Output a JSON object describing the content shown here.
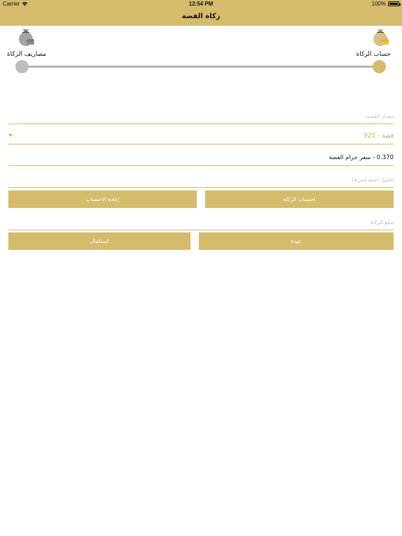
{
  "status_bar": {
    "carrier": "Carrier",
    "time": "12:54 PM",
    "battery": "100%"
  },
  "nav": {
    "title": "زكاة الفضة"
  },
  "steps": {
    "start_label": "حساب الزكاة",
    "end_label": "مصاريف الزكاة",
    "current_step": 1,
    "total_steps": 2
  },
  "form": {
    "silver_amount_placeholder": "مقدار الفضة",
    "silver_type_selected": "فضة - 925",
    "price_per_gram": "0.370 - سعر جرام الفضة",
    "hawl_placeholder": "الحول (سنة قمرية)",
    "zakat_amount_placeholder": "مبلغ الزكاة"
  },
  "buttons": {
    "calculate": "احتساب الزكاة",
    "recalculate": "إعادة الاحتساب",
    "back": "عودة",
    "continue": "استكمال"
  },
  "colors": {
    "accent": "#d5bb6c",
    "inactive": "#bdbdbd"
  }
}
